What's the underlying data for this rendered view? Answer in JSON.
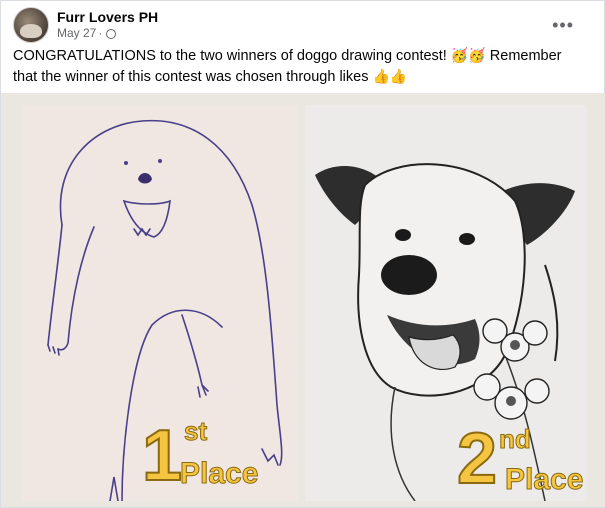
{
  "post": {
    "page_name": "Furr Lovers PH",
    "date": "May 27",
    "separator": "·",
    "caption_part1": "CONGRATULATIONS to the two winners of doggo drawing contest!",
    "caption_emoji1": "🥳🥳",
    "caption_part2": "Remember that the winner of this contest was chosen through likes",
    "caption_emoji2": "👍👍",
    "more_label": "•••"
  },
  "image": {
    "first": {
      "number": "1",
      "suffix": "st",
      "word": "Place"
    },
    "second": {
      "number": "2",
      "suffix": "nd",
      "word": "Place"
    }
  },
  "icons": [
    "globe-icon",
    "more-options-icon",
    "avatar"
  ]
}
